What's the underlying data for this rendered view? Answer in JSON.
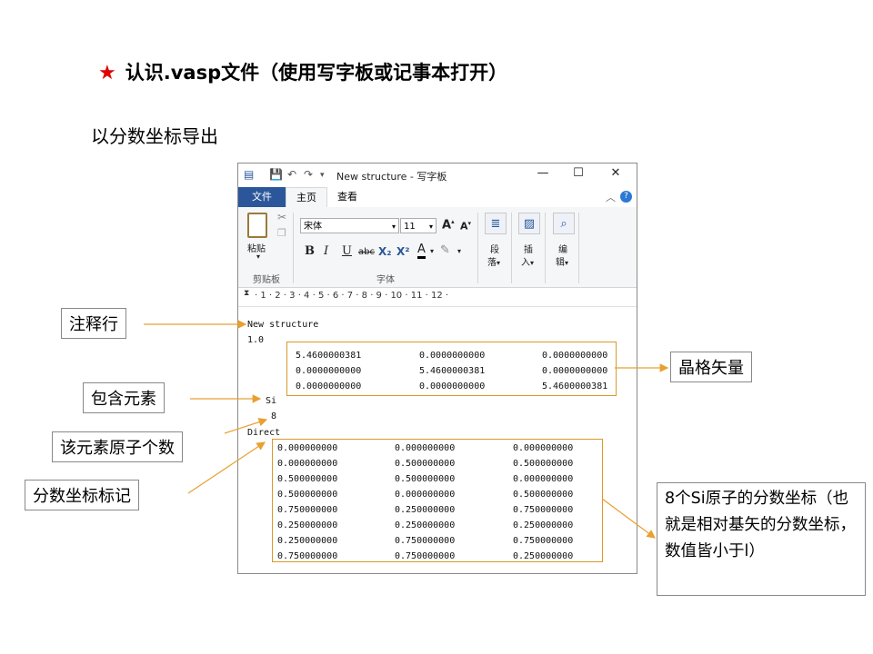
{
  "slide": {
    "title_star": "★",
    "title": "认识.vasp文件（使用写字板或记事本打开）",
    "subtitle": "以分数坐标导出"
  },
  "window": {
    "title": "New structure - 写字板",
    "controls": {
      "minimize": "—",
      "maximize": "☐",
      "close": "✕"
    },
    "tabs": {
      "file": "文件",
      "home": "主页",
      "view": "查看"
    },
    "ribbon": {
      "paste_label": "粘贴",
      "clipboard_group": "剪贴板",
      "font_name": "宋体",
      "font_size": "11",
      "font_group": "字体",
      "bold": "B",
      "italic": "I",
      "underline": "U",
      "strike": "abc",
      "subscript": "X₂",
      "superscript": "X²",
      "font_color": "A",
      "paragraph_label_1": "段",
      "paragraph_label_2": "落",
      "insert_label_1": "插",
      "insert_label_2": "入",
      "edit_label_1": "编",
      "edit_label_2": "辑"
    },
    "ruler_text": "· 1 · 2 · 3 · 4 · 5 · 6 · 7 · 8 · 9 · 10 · 11 · 12 ·",
    "document": {
      "comment_line": "New structure",
      "scale_line": "1.0",
      "lattice": [
        [
          "5.4600000381",
          "0.0000000000",
          "0.0000000000"
        ],
        [
          "0.0000000000",
          "5.4600000381",
          "0.0000000000"
        ],
        [
          "0.0000000000",
          "0.0000000000",
          "5.4600000381"
        ]
      ],
      "element": "Si",
      "count": "8",
      "coord_mode": "Direct",
      "positions": [
        [
          "0.000000000",
          "0.000000000",
          "0.000000000"
        ],
        [
          "0.000000000",
          "0.500000000",
          "0.500000000"
        ],
        [
          "0.500000000",
          "0.500000000",
          "0.000000000"
        ],
        [
          "0.500000000",
          "0.000000000",
          "0.500000000"
        ],
        [
          "0.750000000",
          "0.250000000",
          "0.750000000"
        ],
        [
          "0.250000000",
          "0.250000000",
          "0.250000000"
        ],
        [
          "0.250000000",
          "0.750000000",
          "0.750000000"
        ],
        [
          "0.750000000",
          "0.750000000",
          "0.250000000"
        ]
      ]
    }
  },
  "annotations": {
    "comment": "注释行",
    "lattice": "晶格矢量",
    "element": "包含元素",
    "count": "该元素原子个数",
    "mode": "分数坐标标记",
    "note": "8个Si原子的分数坐标（也就是相对基矢的分数坐标，数值皆小于l）"
  },
  "colors": {
    "accent_star": "#e00000",
    "arrow": "#e8a030",
    "file_tab": "#2b579a"
  }
}
